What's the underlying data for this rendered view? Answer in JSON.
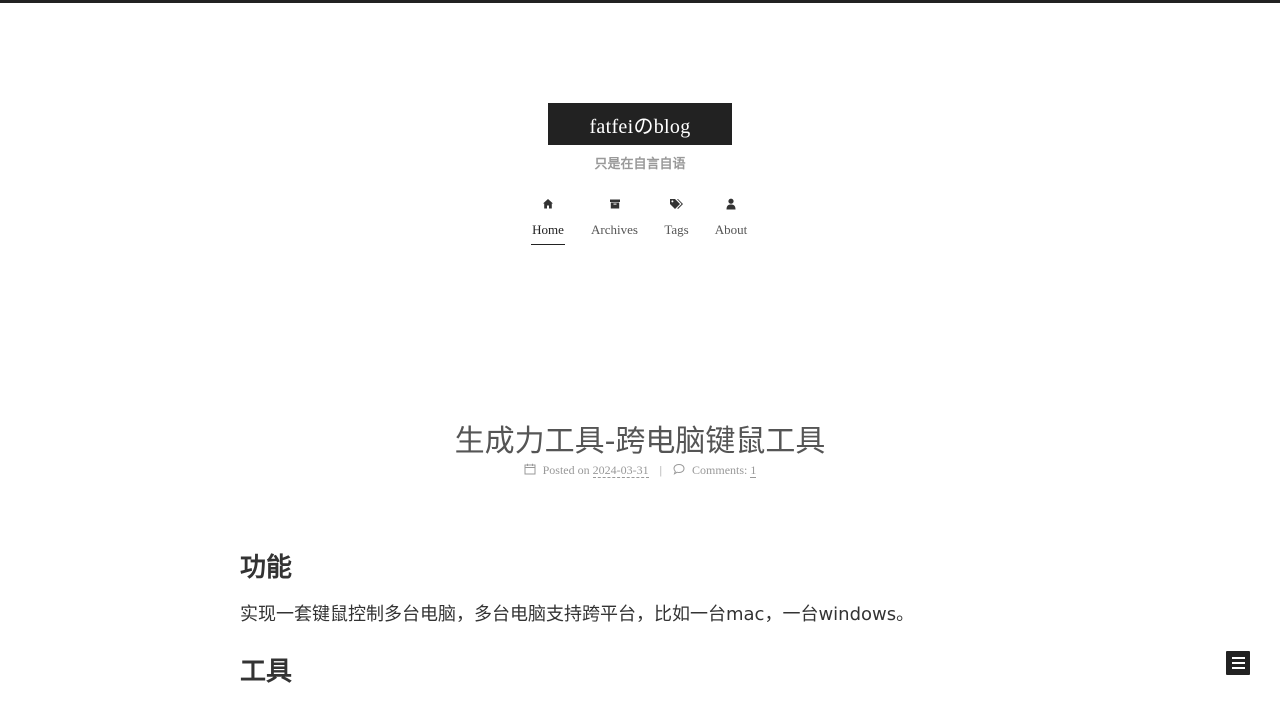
{
  "site": {
    "title": "fatfeiのblog",
    "subtitle": "只是在自言自语"
  },
  "nav": {
    "items": [
      {
        "label": "Home",
        "icon": "home-icon",
        "active": true
      },
      {
        "label": "Archives",
        "icon": "archive-icon",
        "active": false
      },
      {
        "label": "Tags",
        "icon": "tags-icon",
        "active": false
      },
      {
        "label": "About",
        "icon": "user-icon",
        "active": false
      }
    ]
  },
  "post": {
    "title": "生成力工具-跨电脑键鼠工具",
    "meta": {
      "posted_label": "Posted on",
      "date": "2024-03-31",
      "separator": "|",
      "comments_label": "Comments:",
      "comments_count": "1"
    },
    "sections": [
      {
        "heading": "功能",
        "body": "实现一套键鼠控制多台电脑，多台电脑支持跨平台，比如一台mac，一台windows。"
      },
      {
        "heading": "工具"
      }
    ]
  },
  "sidebar_toggle": {
    "icon": "menu-icon"
  },
  "colors": {
    "accent": "#222222",
    "text": "#555555",
    "muted": "#999999"
  }
}
